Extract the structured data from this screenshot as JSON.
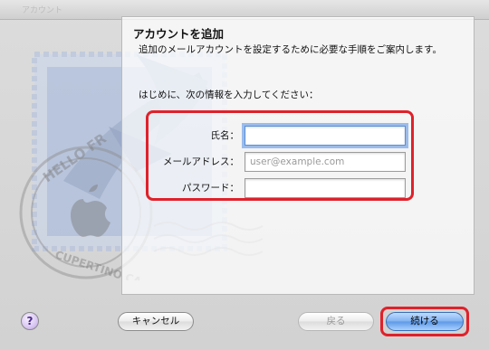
{
  "window": {
    "ghost_title": "アカウント"
  },
  "pane": {
    "title": "アカウントを追加",
    "intro": "追加のメールアカウントを設定するために必要な手順をご案内します。",
    "prompt": "はじめに、次の情報を入力してください："
  },
  "form": {
    "full_name_label": "氏名：",
    "full_name_value": "",
    "email_label": "メールアドレス：",
    "email_placeholder": "user@example.com",
    "password_label": "パスワード："
  },
  "stamp": {
    "text_top": "HELLO FR",
    "text_bottom": "CUPERTINO CA"
  },
  "buttons": {
    "help": "?",
    "cancel": "キャンセル",
    "back": "戻る",
    "continue": "続ける"
  },
  "colors": {
    "highlight": "#e0212a",
    "focus": "#5b8fd6",
    "default_button": "#5c98e6"
  }
}
